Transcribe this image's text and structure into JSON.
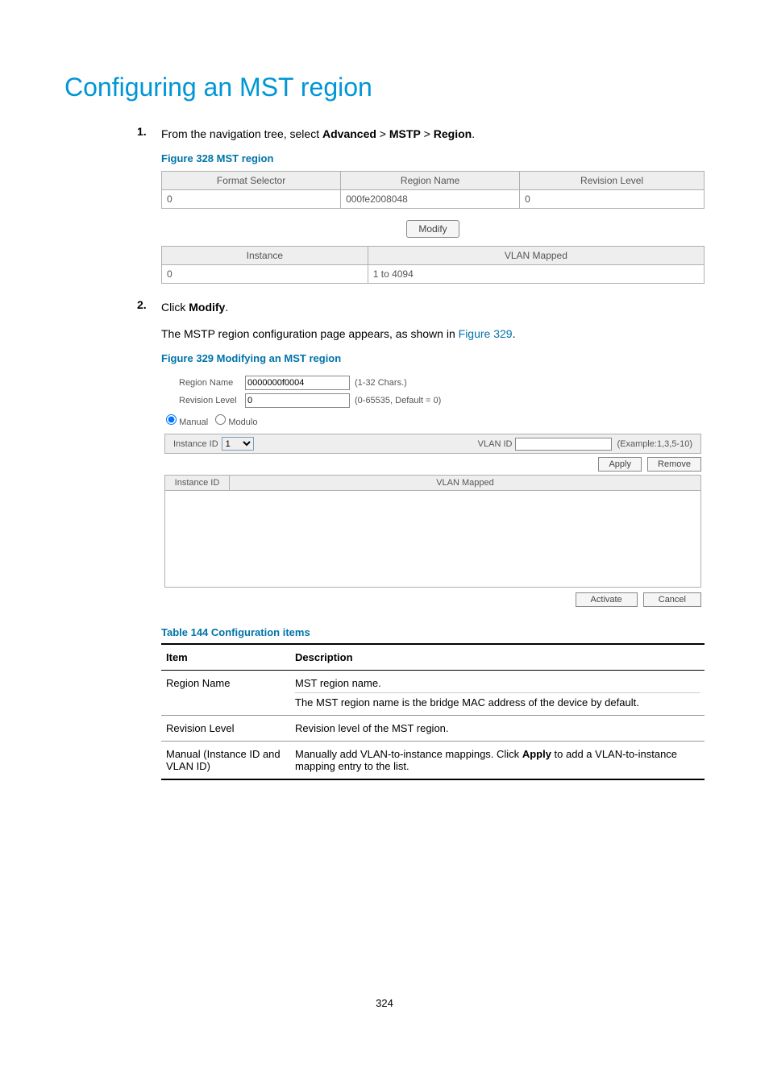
{
  "page": {
    "title": "Configuring an MST region",
    "number": "324"
  },
  "steps": {
    "s1": {
      "num": "1.",
      "pre": "From the navigation tree, select ",
      "b1": "Advanced",
      "sep1": " > ",
      "b2": "MSTP",
      "sep2": " > ",
      "b3": "Region",
      "post": "."
    },
    "s2": {
      "num": "2.",
      "pre": "Click ",
      "b1": "Modify",
      "post": ".",
      "line2a": "The MSTP region configuration page appears, as shown in ",
      "line2link": "Figure 329",
      "line2b": "."
    }
  },
  "fig328": {
    "caption": "Figure 328 MST region",
    "h1": "Format Selector",
    "h2": "Region Name",
    "h3": "Revision Level",
    "r1_c1": "0",
    "r1_c2": "000fe2008048",
    "r1_c3": "0",
    "modify_btn": "Modify",
    "inst_h1": "Instance",
    "inst_h2": "VLAN Mapped",
    "inst_r1_c1": "0",
    "inst_r1_c2": "1 to 4094"
  },
  "fig329": {
    "caption": "Figure 329 Modifying an MST region",
    "region_label": "Region Name",
    "region_value": "0000000f0004",
    "region_hint": "(1-32 Chars.)",
    "rev_label": "Revision Level",
    "rev_value": "0",
    "rev_hint": "(0-65535, Default = 0)",
    "radio_manual": "Manual",
    "radio_modulo": "Modulo",
    "inst_id_label": "Instance ID",
    "inst_id_value": "1",
    "vlan_id_label": "VLAN ID",
    "vlan_example": "(Example:1,3,5-10)",
    "apply_btn": "Apply",
    "remove_btn": "Remove",
    "map_h1": "Instance ID",
    "map_h2": "VLAN Mapped",
    "activate_btn": "Activate",
    "cancel_btn": "Cancel"
  },
  "table144": {
    "caption": "Table 144 Configuration items",
    "h_item": "Item",
    "h_desc": "Description",
    "rows": {
      "r1_item": "Region Name",
      "r1_desc_a": "MST region name.",
      "r1_desc_b": "The MST region name is the bridge MAC address of the device by default.",
      "r2_item": "Revision Level",
      "r2_desc": "Revision level of the MST region.",
      "r3_item": "Manual (Instance ID and VLAN ID)",
      "r3_desc_a": "Manually add VLAN-to-instance mappings. Click ",
      "r3_desc_bold": "Apply",
      "r3_desc_b": " to add a VLAN-to-instance mapping entry to the list."
    }
  }
}
